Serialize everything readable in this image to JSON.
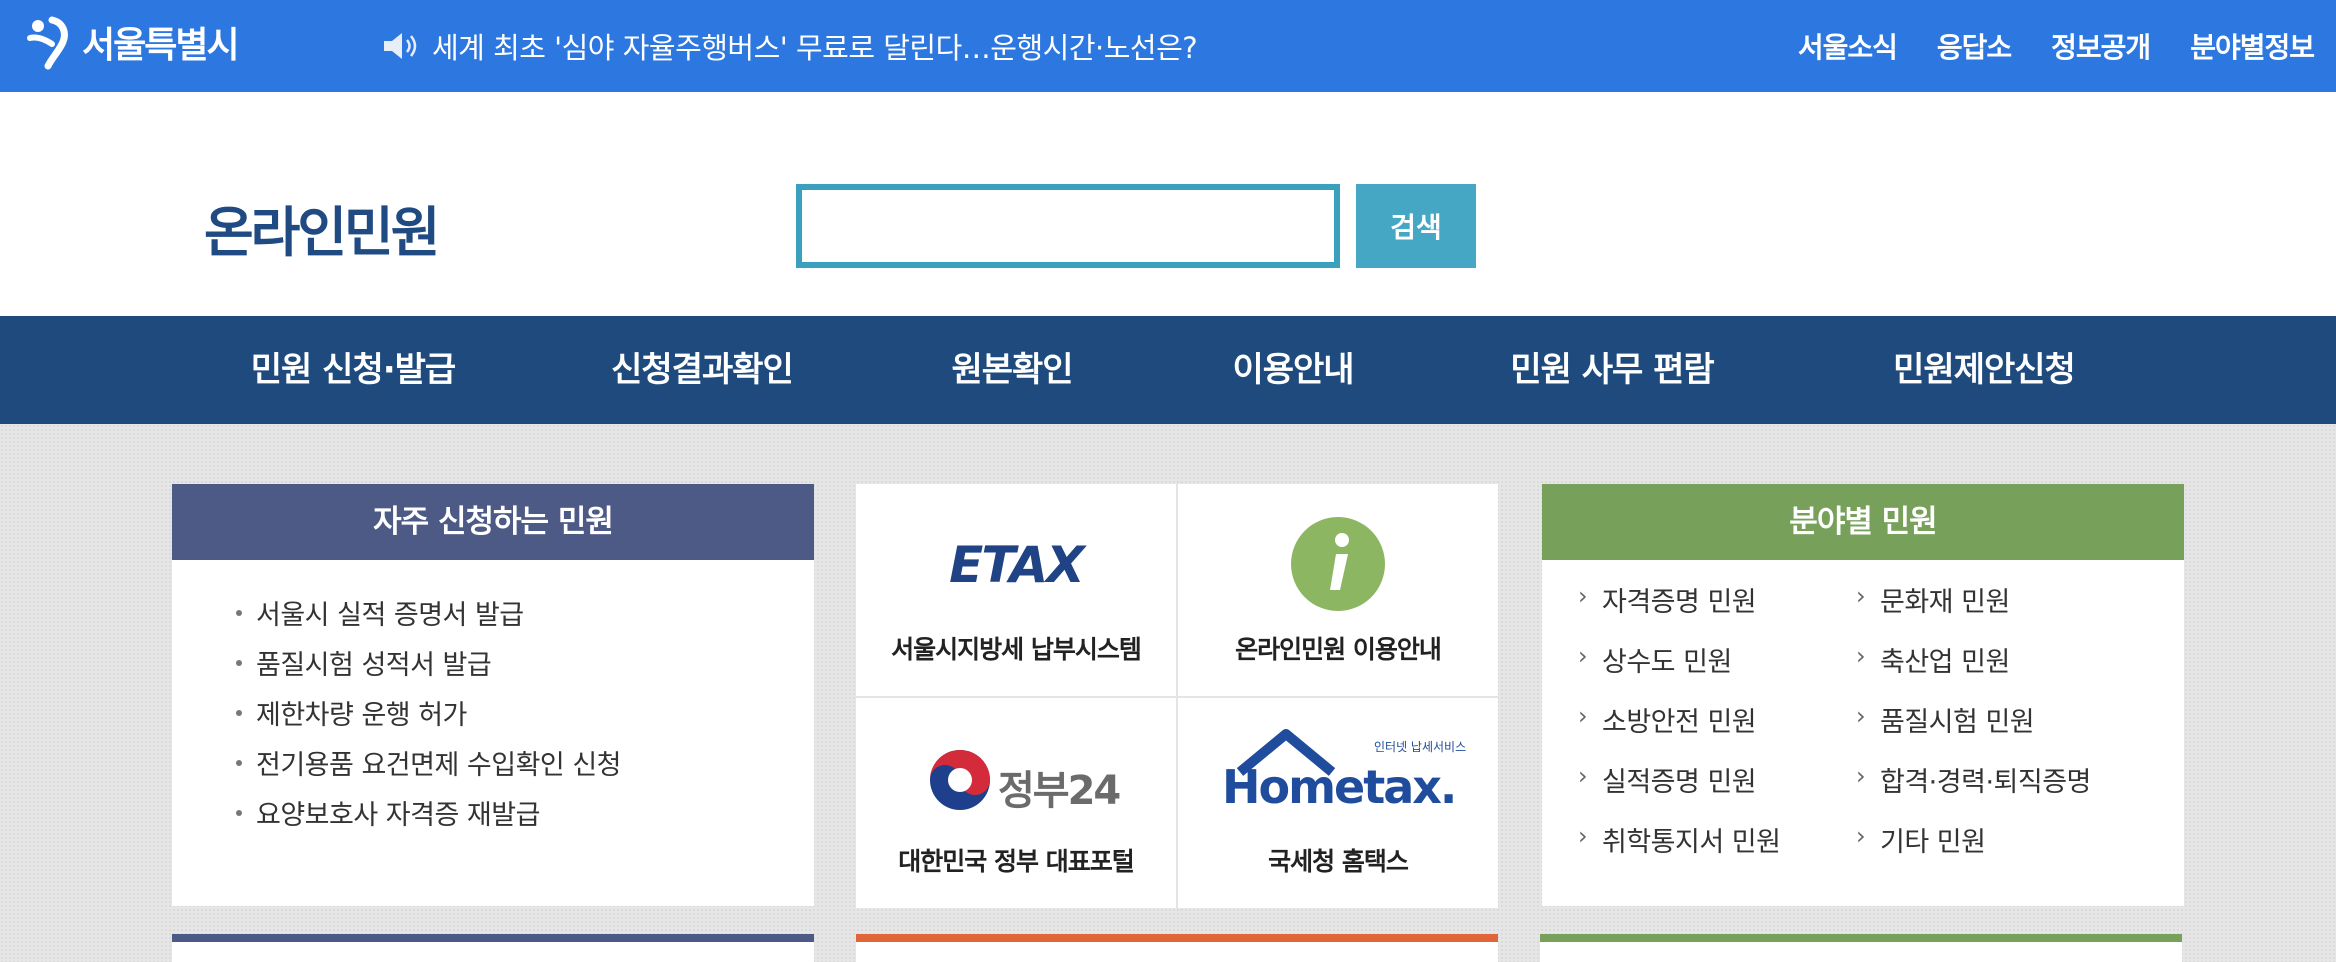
{
  "topbar": {
    "logo_text": "서울특별시",
    "ticker": "세계 최초 '심야 자율주행버스' 무료로 달린다…운행시간·노선은?",
    "nav": [
      "서울소식",
      "응답소",
      "정보공개",
      "분야별정보"
    ]
  },
  "header": {
    "title": "온라인민원",
    "search_placeholder": "",
    "search_button": "검색"
  },
  "mainnav": [
    "민원 신청·발급",
    "신청결과확인",
    "원본확인",
    "이용안내",
    "민원 사무 편람",
    "민원제안신청"
  ],
  "frequent": {
    "title": "자주 신청하는 민원",
    "items": [
      "서울시 실적 증명서 발급",
      "품질시험 성적서 발급",
      "제한차량 운행 허가",
      "전기용품 요건면제 수입확인 신청",
      "요양보호사 자격증 재발급"
    ]
  },
  "links": {
    "etax_logo": "ETAX",
    "etax_caption": "서울시지방세 납부시스템",
    "info_caption": "온라인민원 이용안내",
    "gov24_logo": "정부24",
    "gov24_caption": "대한민국 정부 대표포털",
    "hometax_logo": "Hometax.",
    "hometax_sub": "인터넷 납세서비스",
    "hometax_caption": "국세청 홈택스"
  },
  "field": {
    "title": "분야별 민원",
    "left": [
      "자격증명 민원",
      "상수도 민원",
      "소방안전 민원",
      "실적증명 민원",
      "취학통지서 민원"
    ],
    "right": [
      "문화재 민원",
      "축산업 민원",
      "품질시험 민원",
      "합격·경력·퇴직증명",
      "기타 민원"
    ]
  },
  "colors": {
    "topbar": "#2d77e0",
    "mainnav": "#1e4a7e",
    "freq_header": "#4e5a86",
    "field_header": "#77a05a",
    "orange_bar": "#e0663a",
    "search_border": "#3aa0bd"
  }
}
